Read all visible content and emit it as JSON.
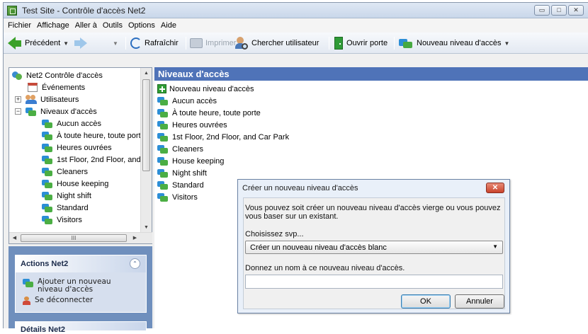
{
  "window": {
    "title": "Test Site - Contrôle d'accès Net2",
    "controls": {
      "minimize": "▭",
      "maximize": "□",
      "close": "✕"
    }
  },
  "menu": [
    "Fichier",
    "Affichage",
    "Aller à",
    "Outils",
    "Options",
    "Aide"
  ],
  "toolbar": {
    "back_label": "Précédent",
    "refresh_label": "Rafraîchir",
    "print_label": "Imprimer",
    "search_user_label": "Chercher utilisateur",
    "open_door_label": "Ouvrir porte",
    "new_level_label": "Nouveau niveau d'accès"
  },
  "tree": {
    "root": "Net2 Contrôle d'accès",
    "events": "Événements",
    "users": "Utilisateurs",
    "levels": "Niveaux d'accès",
    "level_items": [
      "Aucun accès",
      "À toute heure, toute porte",
      "Heures ouvrées",
      "1st Floor, 2nd Floor, and",
      "Cleaners",
      "House keeping",
      "Night shift",
      "Standard",
      "Visitors"
    ],
    "expand_plus": "+",
    "expand_minus": "−",
    "scroll_glyph": "III"
  },
  "actions_panel": {
    "title": "Actions Net2",
    "add_level": "Ajouter un nouveau niveau d'accès",
    "logout": "Se déconnecter",
    "collapse_glyph": "⌃"
  },
  "details_panel": {
    "title": "Détails Net2"
  },
  "main": {
    "header": "Niveaux d'accès",
    "new_item": "Nouveau niveau d'accès",
    "items": [
      "Aucun accès",
      "À toute heure, toute porte",
      "Heures ouvrées",
      "1st Floor, 2nd Floor, and Car Park",
      "Cleaners",
      "House keeping",
      "Night shift",
      "Standard",
      "Visitors"
    ]
  },
  "dialog": {
    "title": "Créer un nouveau niveau d'accès",
    "description_line1": "Vous pouvez soit créer un nouveau niveau d'accès vierge ou vous pouvez",
    "description_line2": "vous baser sur un existant.",
    "choose_label": "Choisissez svp...",
    "selected_option": "Créer un nouveau niveau d'accès blanc",
    "name_label": "Donnez un nom à ce nouveau niveau d'accès.",
    "name_value": "",
    "ok_label": "OK",
    "cancel_label": "Annuler",
    "close_glyph": "✕"
  }
}
